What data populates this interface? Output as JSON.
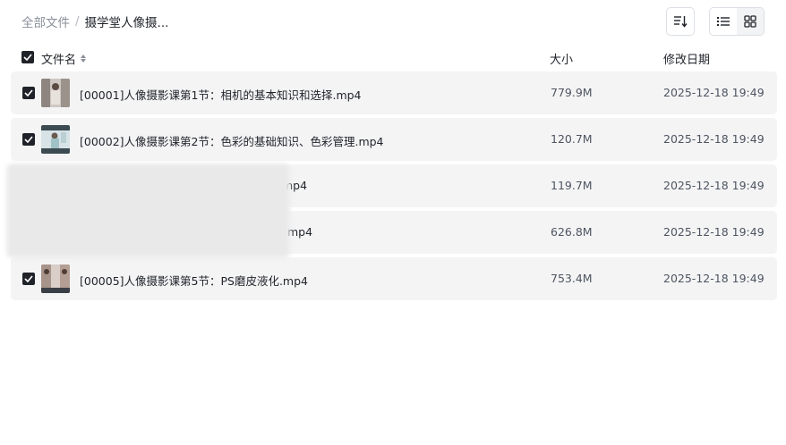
{
  "breadcrumb": {
    "root": "全部文件",
    "separator": "/",
    "current": "摄学堂人像摄..."
  },
  "toolbar": {
    "sort_icon": "sort-list-icon",
    "list_view_icon": "list-view-icon",
    "grid_view_icon": "grid-view-icon",
    "active_view": "list"
  },
  "table": {
    "headers": {
      "name": "文件名",
      "size": "大小",
      "date": "修改日期"
    },
    "rows": [
      {
        "name": "[00001]人像摄影课第1节：相机的基本知识和选择.mp4",
        "size": "779.9M",
        "date": "2025-12-18 19:49",
        "checked": true
      },
      {
        "name": "[00002]人像摄影课第2节：色彩的基础知识、色彩管理.mp4",
        "size": "120.7M",
        "date": "2025-12-18 19:49",
        "checked": true
      },
      {
        "name": "mp4",
        "size": "119.7M",
        "date": "2025-12-18 19:49",
        "checked": true
      },
      {
        "name": "mp4",
        "size": "626.8M",
        "date": "2025-12-18 19:49",
        "checked": true
      },
      {
        "name": "[00005]人像摄影课第5节：PS磨皮液化.mp4",
        "size": "753.4M",
        "date": "2025-12-18 19:49",
        "checked": true
      }
    ]
  },
  "colors": {
    "row_bg": "#f4f4f5",
    "checkbox": "#1f2329",
    "muted_text": "#8a8f99"
  }
}
